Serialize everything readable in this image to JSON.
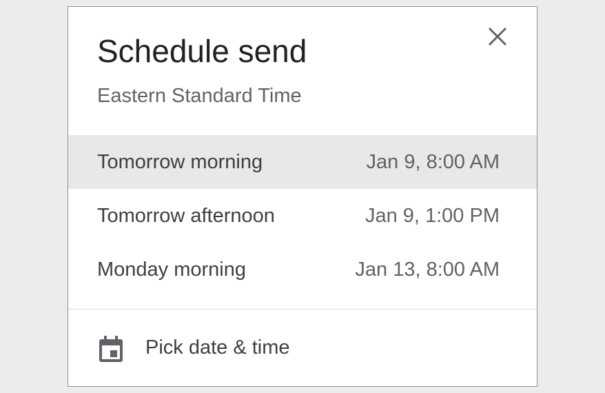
{
  "dialog": {
    "title": "Schedule send",
    "subtitle": "Eastern Standard Time",
    "close_icon": "close-icon",
    "options": [
      {
        "label": "Tomorrow morning",
        "time": "Jan 9, 8:00 AM",
        "highlighted": true
      },
      {
        "label": "Tomorrow afternoon",
        "time": "Jan 9, 1:00 PM",
        "highlighted": false
      },
      {
        "label": "Monday morning",
        "time": "Jan 13, 8:00 AM",
        "highlighted": false
      }
    ],
    "pick": {
      "icon": "calendar-icon",
      "label": "Pick date & time"
    }
  },
  "colors": {
    "background": "#ececec",
    "dialog_bg": "#ffffff",
    "highlight": "#e8e8e8",
    "title_text": "#202124",
    "secondary_text": "#5f6368",
    "icon": "#5f6368"
  }
}
